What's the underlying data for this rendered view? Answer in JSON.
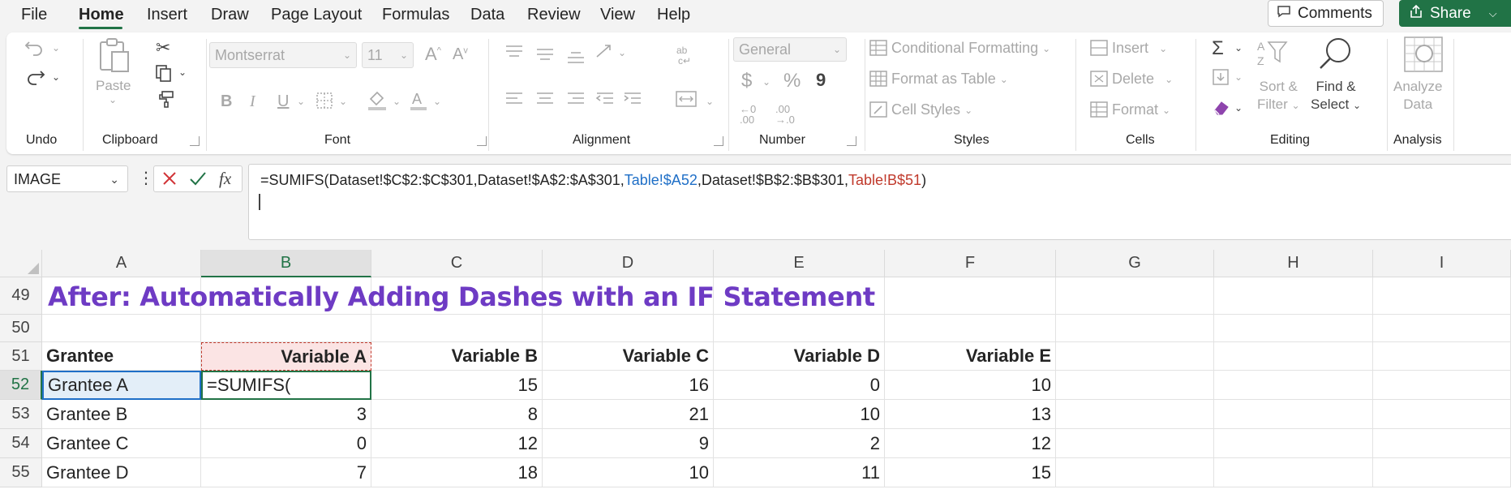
{
  "menu": {
    "items": [
      "File",
      "Home",
      "Insert",
      "Draw",
      "Page Layout",
      "Formulas",
      "Data",
      "Review",
      "View",
      "Help"
    ],
    "active": "Home",
    "comments_label": "Comments",
    "share_label": "Share"
  },
  "ribbon": {
    "undo": {
      "label": "Undo"
    },
    "clipboard": {
      "label": "Clipboard",
      "paste": "Paste"
    },
    "font": {
      "label": "Font",
      "font_name": "Montserrat",
      "font_size": "11",
      "bold": "B",
      "italic": "I",
      "underline": "U",
      "grow": "A",
      "shrink": "A"
    },
    "alignment": {
      "label": "Alignment"
    },
    "number": {
      "label": "Number",
      "format": "General",
      "currency": "$",
      "percent": "%",
      "comma": "9"
    },
    "styles": {
      "label": "Styles",
      "conditional": "Conditional Formatting",
      "format_table": "Format as Table",
      "cell_styles": "Cell Styles"
    },
    "cells": {
      "label": "Cells",
      "insert": "Insert",
      "delete": "Delete",
      "format": "Format"
    },
    "editing": {
      "label": "Editing",
      "sort_filter_1": "Sort &",
      "sort_filter_2": "Filter",
      "find_1": "Find &",
      "find_2": "Select"
    },
    "analysis": {
      "label": "Analysis",
      "analyze_1": "Analyze",
      "analyze_2": "Data"
    }
  },
  "formula_bar": {
    "name_box": "IMAGE",
    "fx": "fx",
    "parts": [
      {
        "text": "=SUMIFS(Dataset!$C$2:$C$301,Dataset!$A$2:$A$301,",
        "color": "default"
      },
      {
        "text": "Table!$A52",
        "color": "#1f6fc7"
      },
      {
        "text": ",Dataset!$B$2:$B$301,",
        "color": "default"
      },
      {
        "text": "Table!B$51",
        "color": "#c0392b"
      },
      {
        "text": ")",
        "color": "default"
      }
    ]
  },
  "sheet": {
    "columns": [
      "A",
      "B",
      "C",
      "D",
      "E",
      "F",
      "G",
      "H",
      "I"
    ],
    "selected_column": "B",
    "rows": [
      "49",
      "50",
      "51",
      "52",
      "53",
      "54",
      "55"
    ],
    "selected_row": "52",
    "title": "After: Automatically Adding Dashes with an IF Statement",
    "title_color": "#6e3bc4",
    "headers": [
      "Grantee",
      "Variable A",
      "Variable B",
      "Variable C",
      "Variable D",
      "Variable E"
    ],
    "data": [
      [
        "Grantee A",
        "=SUMIFS(",
        "15",
        "16",
        "0",
        "10"
      ],
      [
        "Grantee B",
        "3",
        "8",
        "21",
        "10",
        "13"
      ],
      [
        "Grantee C",
        "0",
        "12",
        "9",
        "2",
        "12"
      ],
      [
        "Grantee D",
        "7",
        "18",
        "10",
        "11",
        "15"
      ]
    ]
  },
  "colors": {
    "accent": "#217346",
    "selection_fill": "#e3eef8",
    "header_highlight": "#fbe4e4"
  }
}
